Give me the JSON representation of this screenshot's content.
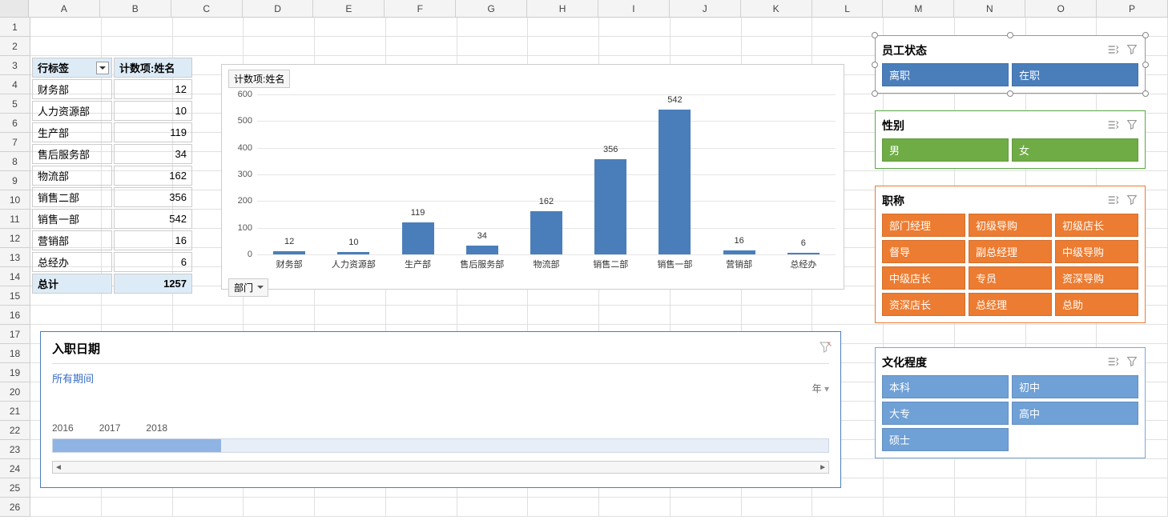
{
  "columns": [
    "A",
    "B",
    "C",
    "D",
    "E",
    "F",
    "G",
    "H",
    "I",
    "J",
    "K",
    "L",
    "M",
    "N",
    "O",
    "P"
  ],
  "rows": 26,
  "pivot": {
    "header_label": "行标签",
    "header_value": "计数项:姓名",
    "rows": [
      {
        "label": "财务部",
        "value": 12
      },
      {
        "label": "人力资源部",
        "value": 10
      },
      {
        "label": "生产部",
        "value": 119
      },
      {
        "label": "售后服务部",
        "value": 34
      },
      {
        "label": "物流部",
        "value": 162
      },
      {
        "label": "销售二部",
        "value": 356
      },
      {
        "label": "销售一部",
        "value": 542
      },
      {
        "label": "营销部",
        "value": 16
      },
      {
        "label": "总经办",
        "value": 6
      }
    ],
    "total_label": "总计",
    "total_value": 1257
  },
  "chart_data": {
    "type": "bar",
    "legend": "计数项:姓名",
    "filter_label": "部门",
    "categories": [
      "财务部",
      "人力资源部",
      "生产部",
      "售后服务部",
      "物流部",
      "销售二部",
      "销售一部",
      "营销部",
      "总经办"
    ],
    "values": [
      12,
      10,
      119,
      34,
      162,
      356,
      542,
      16,
      6
    ],
    "yticks": [
      0,
      100,
      200,
      300,
      400,
      500,
      600
    ],
    "ymax": 600,
    "color": "#4a7ebb"
  },
  "timeline": {
    "title": "入职日期",
    "period": "所有期间",
    "granularity": "年",
    "labels": [
      "2016",
      "2017",
      "2018"
    ]
  },
  "slicers": [
    {
      "id": "slicer1",
      "title": "员工状态",
      "color": "blue",
      "cols": 2,
      "selected": true,
      "items": [
        "离职",
        "在职"
      ]
    },
    {
      "id": "slicer2",
      "title": "性别",
      "color": "green",
      "cols": 2,
      "items": [
        "男",
        "女"
      ]
    },
    {
      "id": "slicer3",
      "title": "职称",
      "color": "orange",
      "cols": 3,
      "items": [
        "部门经理",
        "初级导购",
        "初级店长",
        "督导",
        "副总经理",
        "中级导购",
        "中级店长",
        "专员",
        "资深导购",
        "资深店长",
        "总经理",
        "总助"
      ]
    },
    {
      "id": "slicer4",
      "title": "文化程度",
      "color": "lblue",
      "cols": 2,
      "items": [
        "本科",
        "初中",
        "大专",
        "高中",
        "硕士"
      ]
    }
  ]
}
